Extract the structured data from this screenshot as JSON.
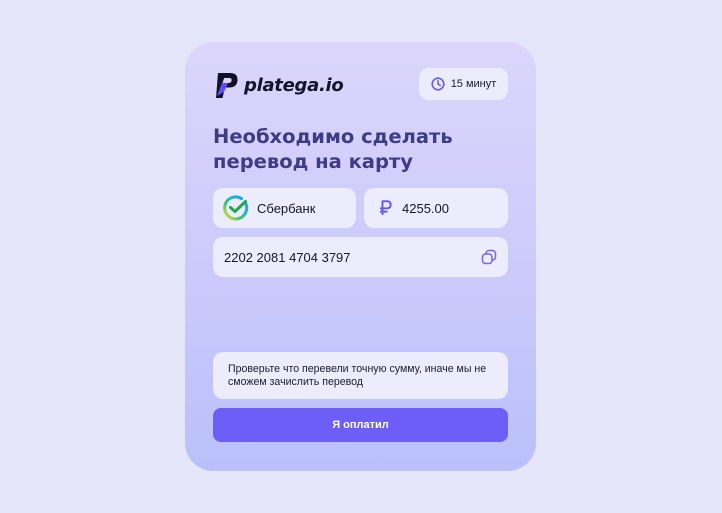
{
  "brand": {
    "name": "platega.io",
    "icon": "platega-logo-icon"
  },
  "timer": {
    "icon": "clock-icon",
    "label": "15 минут"
  },
  "title": "Необходимо сделать перевод на карту",
  "bank": {
    "icon": "sberbank-logo-icon",
    "name": "Сбербанк"
  },
  "amount": {
    "currency_icon": "ruble-icon",
    "value": "4255.00"
  },
  "card": {
    "number": "2202 2081 4704 3797",
    "copy_icon": "copy-icon"
  },
  "notice": "Проверьте что перевели точную сумму, иначе мы не сможем зачислить перевод",
  "pay_button": "Я оплатил",
  "colors": {
    "background": "#e6e6fb",
    "card_top": "#dcd6fb",
    "card_bottom": "#b9c0fb",
    "field": "#ececfc",
    "accent": "#6c5ef7",
    "title": "#3f3b86"
  }
}
